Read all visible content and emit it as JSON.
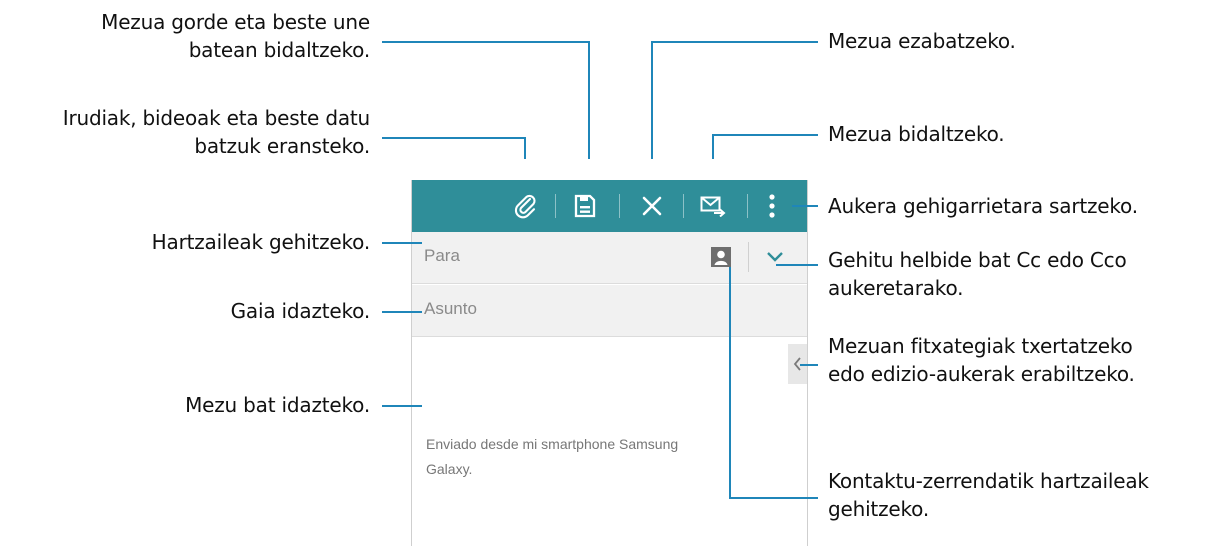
{
  "callouts": {
    "save": {
      "line1": "Mezua gorde eta beste une",
      "line2": "batean bidaltzeko."
    },
    "attach": {
      "line1": "Irudiak, bideoak eta beste datu",
      "line2": "batzuk eransteko."
    },
    "recipients": "Hartzaileak gehitzeko.",
    "subject": "Gaia idazteko.",
    "message": "Mezu bat idazteko.",
    "delete": "Mezua ezabatzeko.",
    "send": "Mezua bidaltzeko.",
    "more": "Aukera gehigarrietara sartzeko.",
    "cc": {
      "line1": "Gehitu helbide bat Cc edo Cco",
      "line2": "aukeretarako."
    },
    "insert": {
      "line1": "Mezuan fitxategiak txertatzeko",
      "line2": "edo edizio-aukerak erabiltzeko."
    },
    "contacts": {
      "line1": "Kontaktu-zerrendatik hartzaileak",
      "line2": "gehitzeko."
    }
  },
  "compose": {
    "to_placeholder": "Para",
    "subject_placeholder": "Asunto",
    "signature_line1": "Enviado desde mi smartphone Samsung",
    "signature_line2": "Galaxy."
  },
  "colors": {
    "action_bar": "#2f8e99",
    "callout_line": "#1f86b9",
    "field_bg": "#f1f1f1"
  },
  "icons": [
    "attach-icon",
    "save-icon",
    "close-icon",
    "send-mail-icon",
    "overflow-menu-icon",
    "contact-icon",
    "chevron-down-icon",
    "chevron-left-icon"
  ]
}
